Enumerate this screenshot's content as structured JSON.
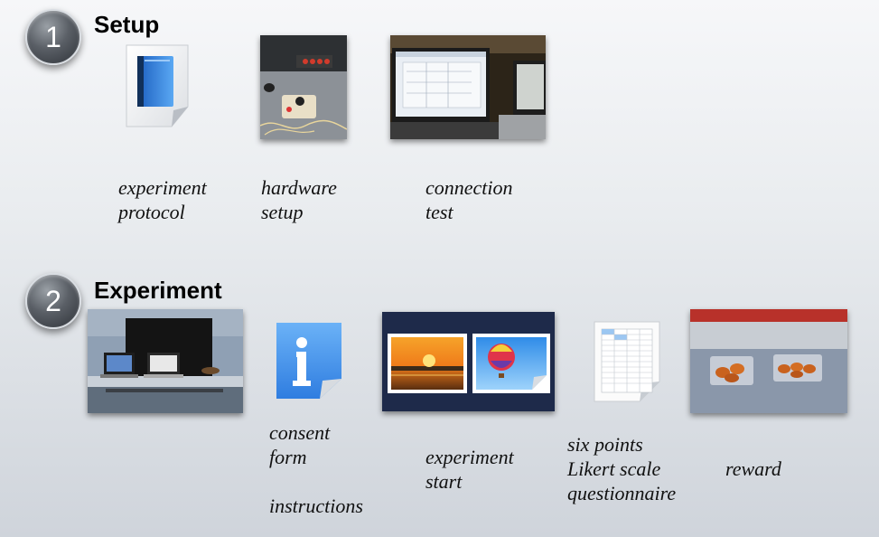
{
  "steps": [
    {
      "number": "1",
      "title": "Setup"
    },
    {
      "number": "2",
      "title": "Experiment"
    }
  ],
  "captions": {
    "experiment_protocol": [
      "experiment",
      "protocol"
    ],
    "hardware_setup": [
      "hardware",
      "setup"
    ],
    "connection_test": [
      "connection",
      "test"
    ],
    "consent_form": [
      "consent",
      "form"
    ],
    "instructions": "instructions",
    "experiment_start": [
      "experiment",
      "start"
    ],
    "questionnaire": [
      "six points",
      "Likert scale",
      "questionnaire"
    ],
    "reward": "reward"
  },
  "icons": {
    "protocol": "book-document-icon",
    "consent": "info-document-icon",
    "experiment_start": "image-documents-icon",
    "questionnaire": "spreadsheet-document-icon"
  },
  "colors": {
    "circle": "#4a4f56",
    "blue_doc": "#3f8fe8",
    "dark_panel": "#1e2a4a"
  }
}
